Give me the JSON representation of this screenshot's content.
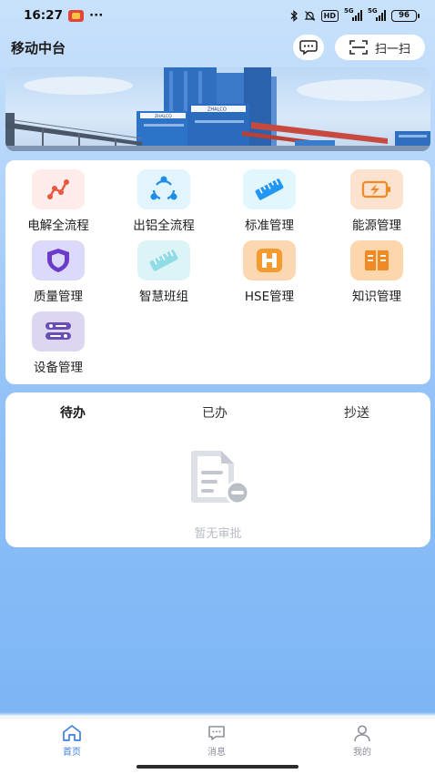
{
  "status_bar": {
    "time": "16:27",
    "dots": "···",
    "hd_label": "HD",
    "signal1_label": "5G",
    "signal2_label": "5G",
    "battery": "96"
  },
  "header": {
    "title": "移动中台",
    "scan_label": "扫一扫"
  },
  "banner": {
    "building_sign_1": "ZHALCO",
    "building_sign_2": "ZHALCO"
  },
  "grid": {
    "items": [
      {
        "label": "电解全流程",
        "icon": "process-chart-icon",
        "bg": "#fdecea",
        "color": "#e8573f"
      },
      {
        "label": "出铝全流程",
        "icon": "share-nodes-icon",
        "bg": "#e2f4fd",
        "color": "#1d8ee6"
      },
      {
        "label": "标准管理",
        "icon": "ruler-icon",
        "bg": "#e2f6fe",
        "color": "#2196f3"
      },
      {
        "label": "能源管理",
        "icon": "battery-bolt-icon",
        "bg": "#fde2cf",
        "color": "#f08a24"
      },
      {
        "label": "质量管理",
        "icon": "shield-icon",
        "bg": "#dcdafb",
        "color": "#6b3cc9"
      },
      {
        "label": "智慧班组",
        "icon": "ruler-icon",
        "bg": "#dcf4f6",
        "color": "#5cc6d6"
      },
      {
        "label": "HSE管理",
        "icon": "hse-icon",
        "bg": "#fbd8b2",
        "color": "#f39a30"
      },
      {
        "label": "知识管理",
        "icon": "book-icon",
        "bg": "#fdd7ab",
        "color": "#f08a24"
      },
      {
        "label": "设备管理",
        "icon": "equipment-icon",
        "bg": "#ddd6f3",
        "color": "#6a4fb3"
      }
    ]
  },
  "tasks": {
    "tabs": [
      "待办",
      "已办",
      "抄送"
    ],
    "active_tab": 0,
    "empty_text": "暂无审批"
  },
  "bottom_nav": {
    "items": [
      {
        "label": "首页",
        "icon": "home-icon",
        "active": true
      },
      {
        "label": "消息",
        "icon": "message-icon",
        "active": false
      },
      {
        "label": "我的",
        "icon": "user-icon",
        "active": false
      }
    ],
    "active_color": "#3f7fe0",
    "inactive_color": "#8a8f98"
  }
}
